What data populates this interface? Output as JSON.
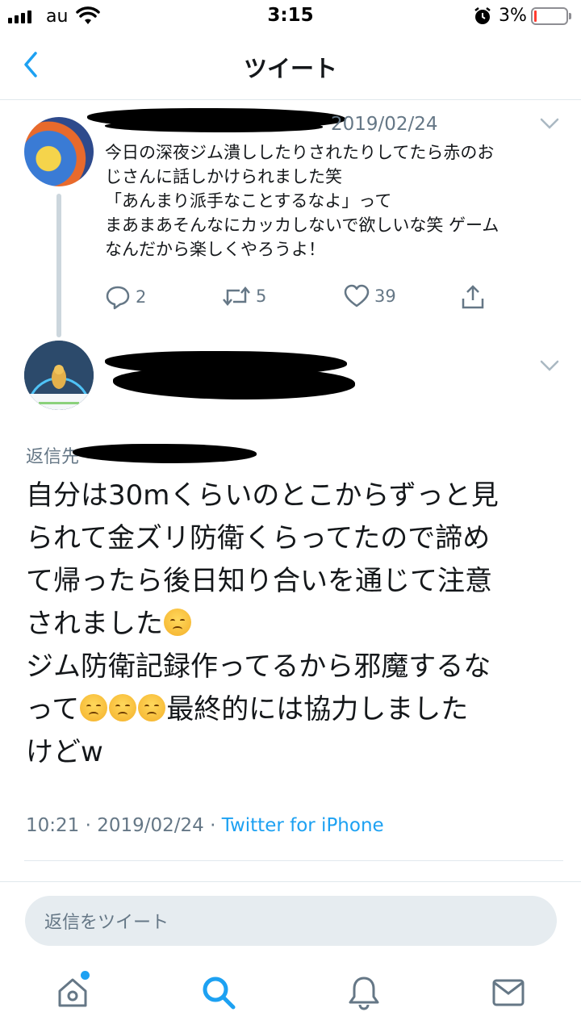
{
  "status_bar": {
    "carrier": "au",
    "time": "3:15",
    "battery_percent": "3%",
    "battery_level": 0.03,
    "icons": [
      "signal-icon",
      "wifi-icon",
      "alarm-icon",
      "battery-icon"
    ]
  },
  "nav": {
    "title": "ツイート",
    "back_icon": "chevron-left-icon"
  },
  "tweet_parent": {
    "date": "2019/02/24",
    "text_lines": [
      "今日の深夜ジム潰ししたりされたりしてたら赤のお",
      "じさんに話しかけられました笑",
      "「あんまり派手なことするなよ」って",
      "まあまあそんなにカッカしないで欲しいな笑 ゲーム",
      "なんだから楽しくやろうよ！"
    ],
    "actions": {
      "reply_count": "2",
      "retweet_count": "5",
      "like_count": "39"
    }
  },
  "tweet_main": {
    "reply_to_label": "返信先",
    "text_lines": [
      "自分は30mくらいのとこからずっと見",
      "られて金ズリ防衛くらってたので諦め",
      "て帰ったら後日知り合いを通じて注意",
      "されました",
      "ジム防衛記録作ってるから邪魔するな",
      "って",
      "最終的には協力しました",
      "けどw"
    ],
    "timestamp": "10:21 · 2019/02/24 · ",
    "source": "Twitter for iPhone"
  },
  "reply_box": {
    "placeholder": "返信をツイート"
  },
  "tab_bar": {
    "tabs": [
      "home-icon",
      "search-icon",
      "notifications-icon",
      "messages-icon"
    ],
    "active": "search-icon"
  },
  "colors": {
    "accent": "#1da1f2",
    "secondary_text": "#657786",
    "divider": "#e1e8ed"
  }
}
